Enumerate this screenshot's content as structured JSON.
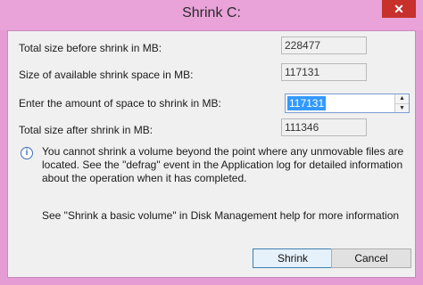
{
  "window": {
    "title": "Shrink C:",
    "close_glyph": "✕"
  },
  "fields": {
    "total_before_label": "Total size before shrink in MB:",
    "total_before_value": "228477",
    "available_label": "Size of available shrink space in MB:",
    "available_value": "117131",
    "amount_label": "Enter the amount of space to shrink in MB:",
    "amount_value": "117131",
    "total_after_label": "Total size after shrink in MB:",
    "total_after_value": "111346"
  },
  "info": {
    "icon": "info-icon",
    "text": "You cannot shrink a volume beyond the point where any unmovable files are located. See the \"defrag\" event in the Application log for detailed information about the operation when it has completed."
  },
  "help": {
    "text": "See \"Shrink a basic volume\" in Disk Management help for more information"
  },
  "buttons": {
    "shrink": "Shrink",
    "cancel": "Cancel"
  },
  "colors": {
    "frame": "#e59bd4",
    "close": "#c7302b",
    "selection": "#3399ff"
  }
}
